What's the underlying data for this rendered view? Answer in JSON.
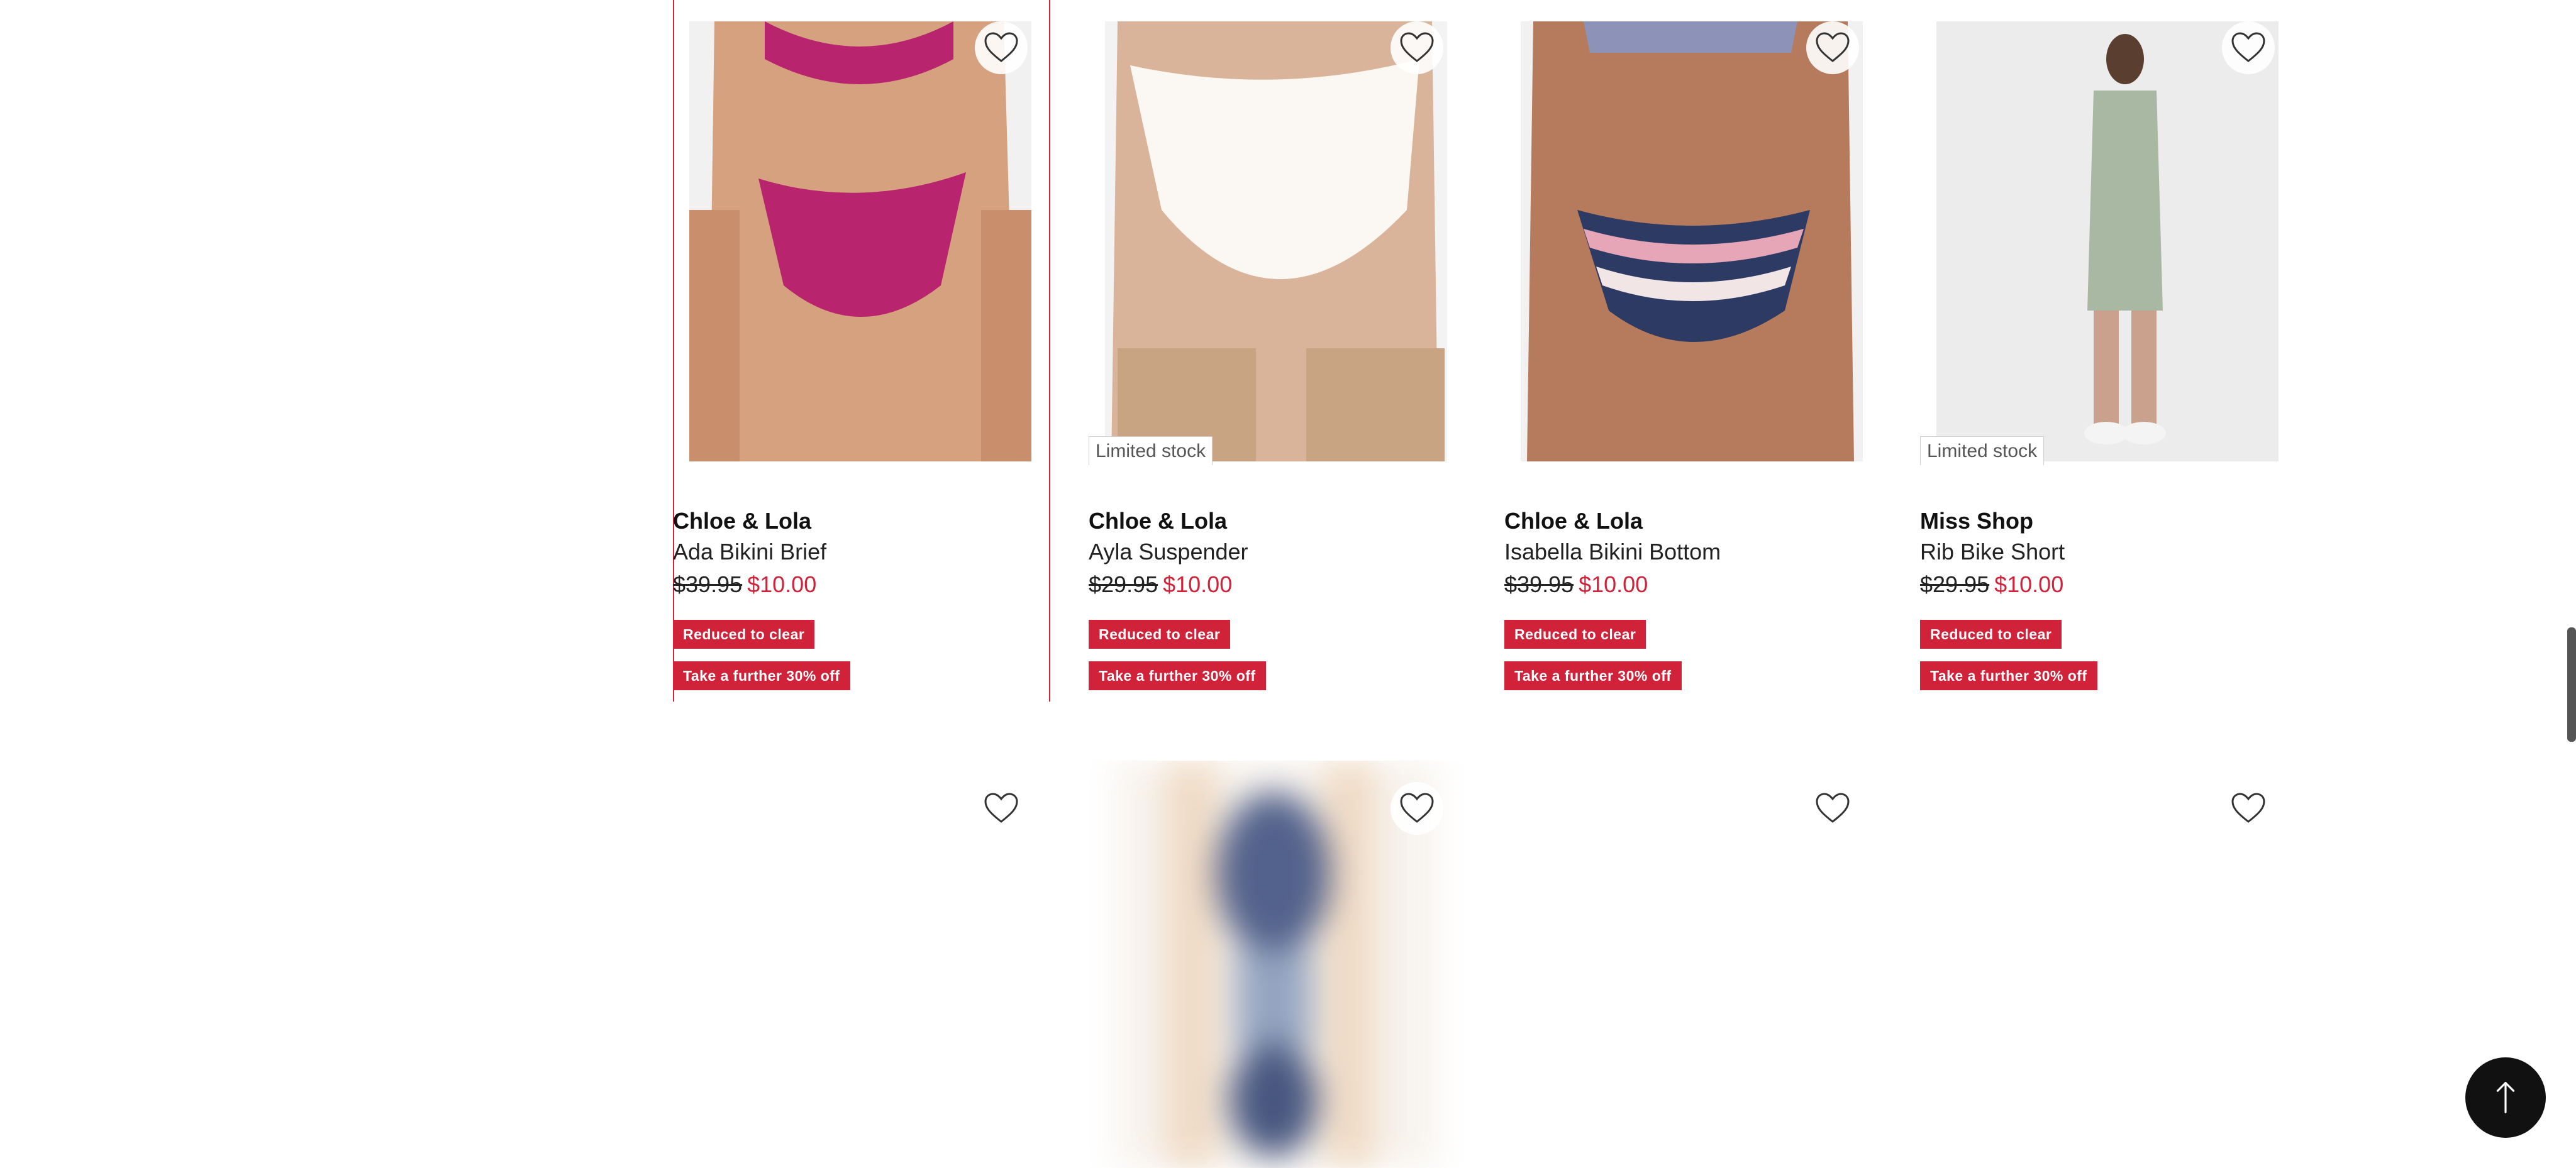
{
  "colors": {
    "accent": "#d0233a",
    "text": "#222222",
    "limited_border": "#cfcfcf"
  },
  "products": [
    {
      "brand": "Chloe & Lola",
      "name": "Ada Bikini Brief",
      "was_price": "$39.95",
      "now_price": "$10.00",
      "badge_1": "Reduced to clear",
      "badge_2": "Take a further 30% off",
      "limited": "",
      "selected": true
    },
    {
      "brand": "Chloe & Lola",
      "name": "Ayla Suspender",
      "was_price": "$29.95",
      "now_price": "$10.00",
      "badge_1": "Reduced to clear",
      "badge_2": "Take a further 30% off",
      "limited": "Limited stock"
    },
    {
      "brand": "Chloe & Lola",
      "name": "Isabella Bikini Bottom",
      "was_price": "$39.95",
      "now_price": "$10.00",
      "badge_1": "Reduced to clear",
      "badge_2": "Take a further 30% off",
      "limited": ""
    },
    {
      "brand": "Miss Shop",
      "name": "Rib Bike Short",
      "was_price": "$29.95",
      "now_price": "$10.00",
      "badge_1": "Reduced to clear",
      "badge_2": "Take a further 30% off",
      "limited": "Limited stock"
    }
  ],
  "icons": {
    "wishlist": "heart-outline-icon",
    "back_to_top": "arrow-up-icon"
  }
}
